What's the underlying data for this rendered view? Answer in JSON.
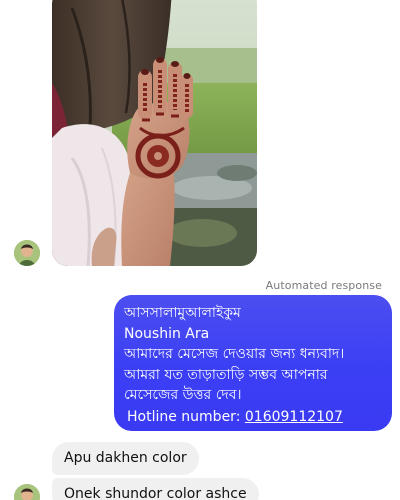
{
  "thread": {
    "automated_label": "Automated response",
    "auto_reply_lines": [
      "আসসালামুআলাইকুম",
      "Noushin Ara",
      "আমাদের মেসেজ দেওয়ার জন্য ধন্যবাদ।",
      "আমরা যত তাড়াতাড়ি সম্ভব আপনার মেসেজের উত্তর দেব।"
    ],
    "hotline_label": "Hotline number:",
    "hotline_number": "01609112107",
    "incoming_messages": [
      "Apu dakhen color",
      "Onek shundor color ashce"
    ]
  },
  "colors": {
    "outgoing_bubble": "#3b3ff4",
    "incoming_bubble": "#f0f0f0",
    "meta_text": "#7a7a7a"
  },
  "icons": {
    "avatar": "contact-avatar",
    "photo": "hand-henna-photo"
  }
}
